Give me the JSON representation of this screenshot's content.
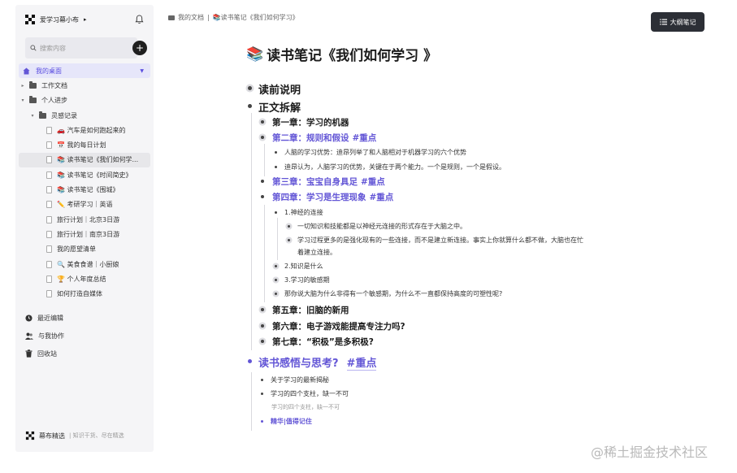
{
  "sidebar": {
    "workspace": "爱学习幕小布",
    "workspace_caret": "▸",
    "search_placeholder": "搜索内容",
    "add": "+",
    "items": [
      {
        "label": "我的桌面",
        "caret": "",
        "icon": "home-icon",
        "state": "active",
        "indent": 0
      },
      {
        "label": "工作文档",
        "caret": "▸",
        "icon": "folder-icon",
        "state": "",
        "indent": 0
      },
      {
        "label": "个人进步",
        "caret": "▾",
        "icon": "folder-icon",
        "state": "",
        "indent": 0
      },
      {
        "label": "灵感记录",
        "caret": "▾",
        "icon": "folder-icon",
        "state": "",
        "indent": 1
      },
      {
        "label": "🚗 汽车是如何跑起来的",
        "caret": "",
        "icon": "doc-icon",
        "state": "",
        "indent": 2
      },
      {
        "label": "📅 我的每日计划",
        "caret": "",
        "icon": "doc-icon",
        "state": "",
        "indent": 2
      },
      {
        "label": "📚 读书笔记《我们如何学...",
        "caret": "",
        "icon": "doc-icon",
        "state": "selected",
        "indent": 2
      },
      {
        "label": "📚 读书笔记《时间简史》",
        "caret": "",
        "icon": "doc-icon",
        "state": "",
        "indent": 2
      },
      {
        "label": "📚 读书笔记《围城》",
        "caret": "",
        "icon": "doc-icon",
        "state": "",
        "indent": 2
      },
      {
        "label": "✏️ 考研学习｜英语",
        "caret": "",
        "icon": "doc-icon",
        "state": "",
        "indent": 2
      },
      {
        "label": "旅行计划｜北京3日游",
        "caret": "",
        "icon": "doc-icon",
        "state": "",
        "indent": 2
      },
      {
        "label": "旅行计划｜南京3日游",
        "caret": "",
        "icon": "doc-icon",
        "state": "",
        "indent": 2
      },
      {
        "label": "我的愿望清单",
        "caret": "",
        "icon": "doc-icon",
        "state": "",
        "indent": 2
      },
      {
        "label": "🔍 美食食谱｜小厨娘",
        "caret": "",
        "icon": "doc-icon",
        "state": "",
        "indent": 2
      },
      {
        "label": "🏆 个人年度总结",
        "caret": "",
        "icon": "doc-icon",
        "state": "",
        "indent": 2
      },
      {
        "label": "如何打造自媒体",
        "caret": "",
        "icon": "doc-icon",
        "state": "",
        "indent": 2
      }
    ],
    "links": [
      {
        "label": "最近编辑",
        "icon": "clock-icon"
      },
      {
        "label": "与我协作",
        "icon": "users-icon"
      },
      {
        "label": "回收站",
        "icon": "trash-icon"
      }
    ],
    "footer": {
      "label": "幕布精选",
      "sub": "知识干货、尽在精选"
    }
  },
  "breadcrumb": {
    "root": "我的文档",
    "sep": "|",
    "current": "📚读书笔记《我们如何学习》"
  },
  "outline_button": "大纲笔记",
  "title": {
    "emoji": "📚",
    "text": "读书笔记《我们如何学习 》"
  },
  "outline": {
    "n1": "读前说明",
    "n2": "正文拆解",
    "c1": "第一章：学习的机器",
    "c2": "第二章：规则和假设",
    "c2_tag": "#重点",
    "c2a": "人脑的学习优势：迪昂列举了和人脑相对于机器学习的六个优势",
    "c2b": "迪昂认为，人脑学习的优势，关键在于两个能力。一个是规则，一个是假设。",
    "c3": "第三章：宝宝自身具足",
    "c3_tag": "#重点",
    "c4": "第四章：学习是生理现象",
    "c4_tag": "#重点",
    "c4a": "1.神经的连接",
    "c4a1": "一切知识和技能都是以神经元连接的形式存在于大脑之中。",
    "c4a2a": "学习过程更多的是强化现有的一些连接，而不是建立新连接。事实上你就算什么都不做，大脑也在忙",
    "c4a2b": "着建立连接。",
    "c4b": "2.知识是什么",
    "c4c": "3.学习的敏感期",
    "c4d": "那你说大脑为什么非得有一个敏感期，为什么不一直都保持高度的可塑性呢?",
    "c5": "第五章：旧脑的新用",
    "c6": "第六章：电子游戏能提高专注力吗?",
    "c7": "第七章：“积极”是多积极?",
    "n3": "读书感悟与思考?",
    "n3_tag": "#重点",
    "n3a": "关于学习的最新揭秘",
    "n3b": "学习的四个支柱，缺一不可",
    "n3b_note": "学习的四个支柱，缺一不可",
    "n3c": "精华|值得记住"
  },
  "watermark": "@稀土掘金技术社区",
  "colors": {
    "accent": "#6356d6",
    "sidebar_bg": "#f5f5f7",
    "active_bg": "#e6e6fa",
    "button_dark": "#2c2f36"
  }
}
